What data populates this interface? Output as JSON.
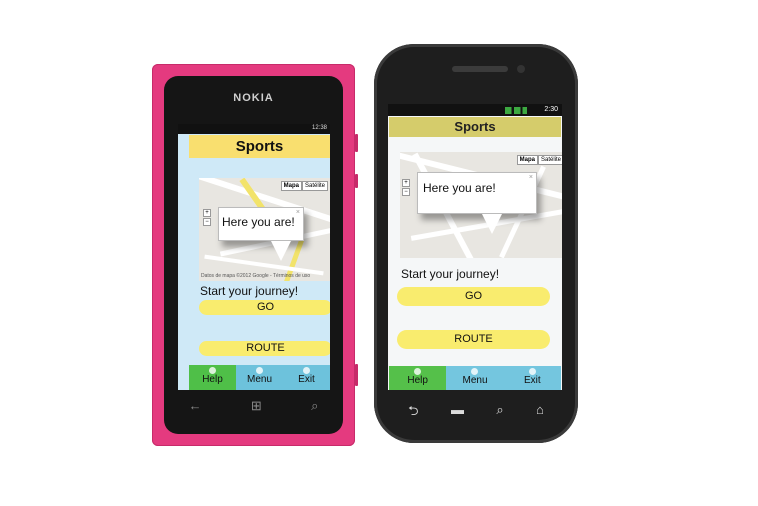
{
  "nokia": {
    "brand": "NOKIA",
    "status_time": "12:38",
    "title": "Sports",
    "map": {
      "map_type_options": [
        "Mapa",
        "Satélite"
      ],
      "zoom_in": "+",
      "zoom_out": "−",
      "bubble_text": "Here you are!",
      "close": "×",
      "footer": "Datos de mapa ©2012 Google - Términos de uso"
    },
    "journey_text": "Start your journey!",
    "go_label": "GO",
    "route_label": "ROUTE",
    "tabs": [
      {
        "label": "Help"
      },
      {
        "label": "Menu"
      },
      {
        "label": "Exit"
      }
    ],
    "nav_keys": [
      "←",
      "⊞",
      "⌕"
    ]
  },
  "android": {
    "status_time": "2:30",
    "title": "Sports",
    "map": {
      "map_type_options": [
        "Mapa",
        "Satélite"
      ],
      "zoom_in": "+",
      "zoom_out": "−",
      "bubble_text": "Here you are!",
      "close": "×"
    },
    "journey_text": "Start your journey!",
    "go_label": "GO",
    "route_label": "ROUTE",
    "tabs": [
      {
        "label": "Help"
      },
      {
        "label": "Menu"
      },
      {
        "label": "Exit"
      }
    ],
    "nav_keys": [
      "⮌",
      "▬",
      "⌕",
      "⌂"
    ]
  },
  "colors": {
    "title_yellow": "#f9df6f",
    "button_yellow": "#f9ec6e",
    "help_green": "#4fbf48",
    "tab_blue": "#6dc2dc",
    "nokia_pink": "#e43a7f"
  }
}
